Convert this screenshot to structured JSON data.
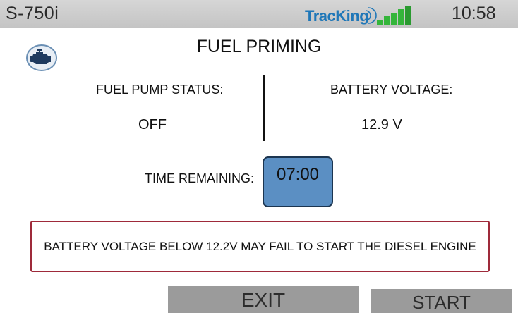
{
  "statusbar": {
    "device_name": "S-750i",
    "brand": "TracKing",
    "clock": "10:58"
  },
  "icons": {
    "engine": "engine-icon",
    "signal": "signal-bars-icon"
  },
  "page": {
    "title": "FUEL PRIMING"
  },
  "fuel_pump": {
    "label": "FUEL PUMP STATUS:",
    "value": "OFF"
  },
  "battery": {
    "label": "BATTERY VOLTAGE:",
    "value": "12.9 V"
  },
  "timer": {
    "label": "TIME REMAINING:",
    "value": "07:00"
  },
  "warning": {
    "text": "BATTERY VOLTAGE BELOW 12.2V MAY FAIL TO START THE DIESEL ENGINE"
  },
  "buttons": {
    "exit": "EXIT",
    "start": "START"
  },
  "colors": {
    "statusbar_bg": "#c8c8c8",
    "brand_blue": "#1f77b8",
    "timer_bg": "#5b8fc3",
    "warning_border": "#9e2a3a",
    "button_bg": "#9b9b9b"
  }
}
